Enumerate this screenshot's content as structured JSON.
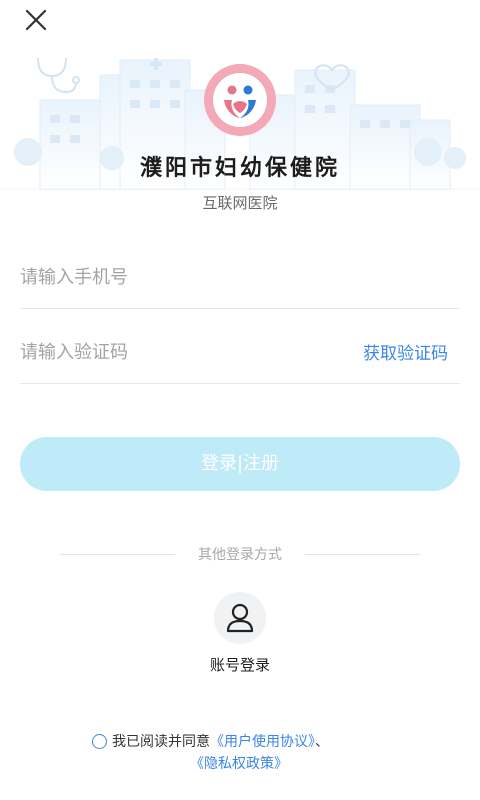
{
  "hospital": {
    "name": "濮阳市妇幼保健院",
    "subtitle": "互联网医院"
  },
  "icons": {
    "close": "close-icon",
    "stethoscope": "stethoscope-icon",
    "heart": "heart-icon",
    "user": "user-icon",
    "logo": "hospital-logo"
  },
  "form": {
    "phone_placeholder": "请输入手机号",
    "phone_value": "",
    "code_placeholder": "请输入验证码",
    "code_value": "",
    "get_code_label": "获取验证码",
    "login_label": "登录|注册"
  },
  "other_login": {
    "divider_label": "其他登录方式",
    "account_login_label": "账号登录"
  },
  "agreement": {
    "prefix": "我已阅读并同意",
    "user_agreement": "《用户使用协议》",
    "separator": "、",
    "privacy_policy": "《隐私权政策》"
  },
  "colors": {
    "accent": "#3a86e8",
    "login_button_bg": "#bfeaf8",
    "logo_pink": "#e7758a",
    "logo_blue": "#2d7bd6"
  }
}
